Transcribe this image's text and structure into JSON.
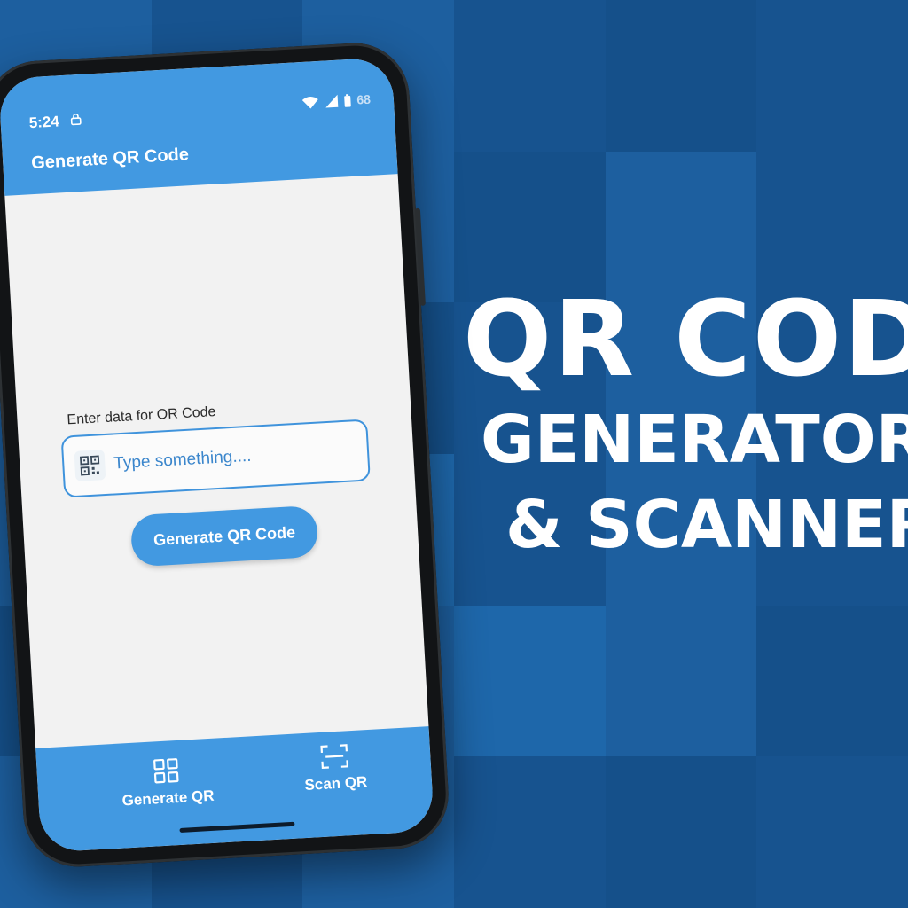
{
  "status_bar": {
    "time": "5:24",
    "battery": "68"
  },
  "app_bar": {
    "title": "Generate QR Code"
  },
  "form": {
    "label": "Enter data for OR Code",
    "placeholder": "Type something....",
    "button_label": "Generate QR Code"
  },
  "bottom_nav": {
    "items": [
      {
        "label": "Generate QR",
        "icon": "qr-grid-icon"
      },
      {
        "label": "Scan QR",
        "icon": "scan-frame-icon"
      }
    ]
  },
  "promo": {
    "line1": "QR COD",
    "line2": "GENERATOR",
    "line3": "& SCANNER"
  },
  "colors": {
    "accent": "#4299e1",
    "background": "#1b5a98",
    "screen": "#f2f2f2"
  }
}
